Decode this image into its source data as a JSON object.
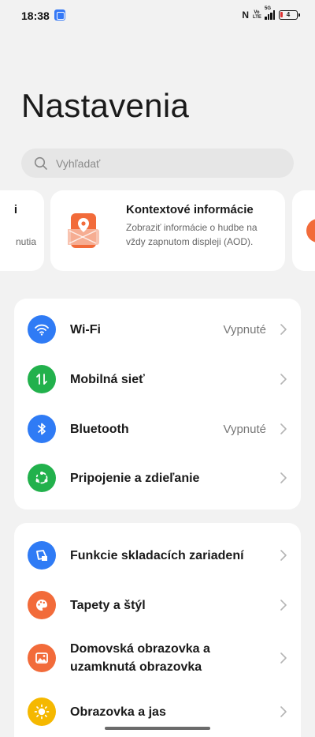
{
  "status_bar": {
    "time": "18:38",
    "nfc": "N",
    "volte": "Vo LTE",
    "network": "5G",
    "battery": "4"
  },
  "page": {
    "title": "Nastavenia"
  },
  "search": {
    "placeholder": "Vyhľadať"
  },
  "carousel": {
    "left_fragment_title": "i",
    "left_fragment_desc": "nutia",
    "card": {
      "title": "Kontextové informácie",
      "description": "Zobraziť informácie o hudbe na vždy zapnutom displeji (AOD)."
    }
  },
  "group1": {
    "items": [
      {
        "label": "Wi-Fi",
        "value": "Vypnuté",
        "icon": "wifi-icon",
        "color": "#2f7bf5"
      },
      {
        "label": "Mobilná sieť",
        "value": "",
        "icon": "mobile-data-icon",
        "color": "#22b14c"
      },
      {
        "label": "Bluetooth",
        "value": "Vypnuté",
        "icon": "bluetooth-icon",
        "color": "#2f7bf5"
      },
      {
        "label": "Pripojenie a zdieľanie",
        "value": "",
        "icon": "share-icon",
        "color": "#22b14c"
      }
    ]
  },
  "group2": {
    "items": [
      {
        "label": "Funkcie skladacích zariadení",
        "icon": "foldable-icon",
        "color": "#2f7bf5"
      },
      {
        "label": "Tapety a štýl",
        "icon": "palette-icon",
        "color": "#f26b3a"
      },
      {
        "label": "Domovská obrazovka a uzamknutá obrazovka",
        "icon": "image-icon",
        "color": "#f26b3a"
      },
      {
        "label": "Obrazovka a jas",
        "icon": "sun-icon",
        "color": "#f5b800"
      }
    ]
  },
  "colors": {
    "background": "#f2f2f2",
    "card": "#ffffff",
    "blue": "#2f7bf5",
    "green": "#22b14c",
    "orange": "#f26b3a",
    "yellow": "#f5b800"
  }
}
